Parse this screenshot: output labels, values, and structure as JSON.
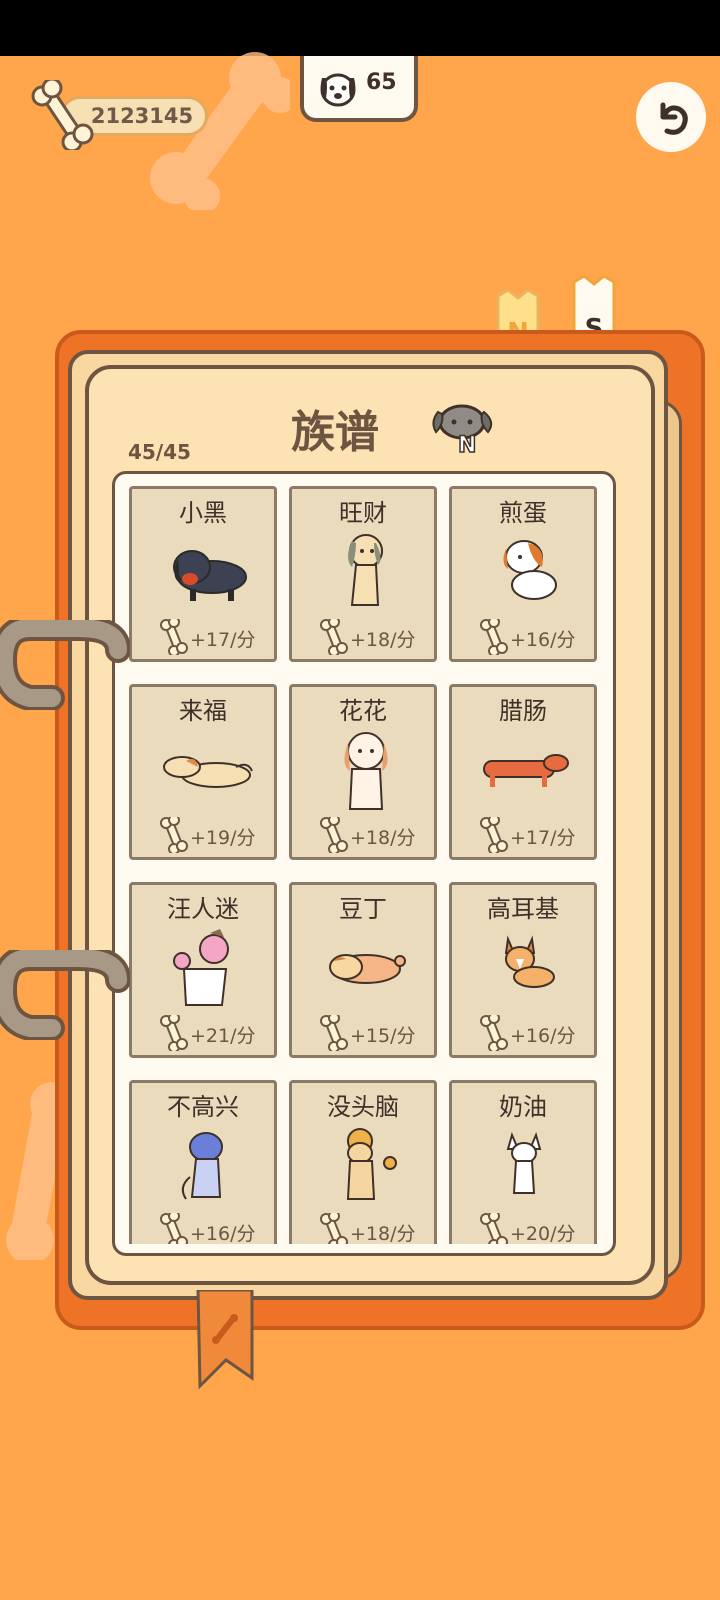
{
  "hud": {
    "bones_total": "2123145",
    "dog_count": "65",
    "back_icon": "undo-arrow-icon"
  },
  "book": {
    "title": "族谱",
    "collected": "45/45",
    "tabs": [
      {
        "label": "N",
        "color": "#ffe08a"
      },
      {
        "label": "S",
        "color": "#fffaf0"
      }
    ]
  },
  "dogs": [
    {
      "name": "小黑",
      "rate": "+17/分",
      "icon": "black-dachshund-icon"
    },
    {
      "name": "旺财",
      "rate": "+18/分",
      "icon": "beige-hound-icon"
    },
    {
      "name": "煎蛋",
      "rate": "+16/分",
      "icon": "spotted-beagle-icon"
    },
    {
      "name": "来福",
      "rate": "+19/分",
      "icon": "lying-tan-dog-icon"
    },
    {
      "name": "花花",
      "rate": "+18/分",
      "icon": "sitting-spaniel-icon"
    },
    {
      "name": "腊肠",
      "rate": "+17/分",
      "icon": "red-dachshund-icon"
    },
    {
      "name": "汪人迷",
      "rate": "+21/分",
      "icon": "pink-poodle-icon"
    },
    {
      "name": "豆丁",
      "rate": "+15/分",
      "icon": "sleeping-pug-icon"
    },
    {
      "name": "高耳基",
      "rate": "+16/分",
      "icon": "corgi-icon"
    },
    {
      "name": "不高兴",
      "rate": "+16/分",
      "icon": "blue-dog-icon"
    },
    {
      "name": "没头脑",
      "rate": "+18/分",
      "icon": "curly-yellow-dog-icon"
    },
    {
      "name": "奶油",
      "rate": "+20/分",
      "icon": "chihuahua-icon"
    }
  ]
}
